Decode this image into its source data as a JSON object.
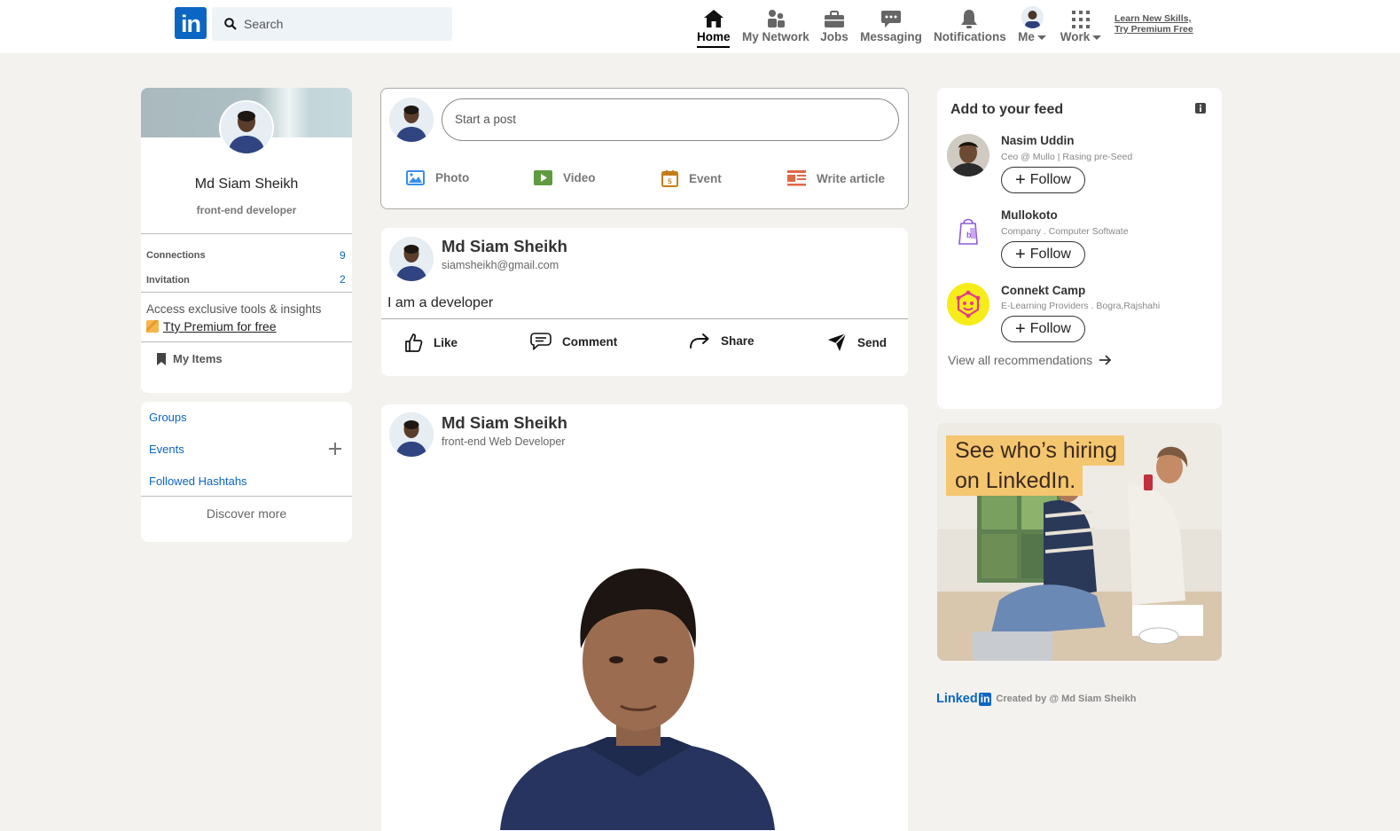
{
  "nav": {
    "logo_text": "in",
    "search_placeholder": "Search",
    "items": [
      {
        "label": "Home",
        "icon": "home-icon"
      },
      {
        "label": "My Network",
        "icon": "network-icon"
      },
      {
        "label": "Jobs",
        "icon": "briefcase-icon"
      },
      {
        "label": "Messaging",
        "icon": "messaging-icon"
      },
      {
        "label": "Notifications",
        "icon": "bell-icon"
      },
      {
        "label": "Me",
        "icon": "avatar"
      },
      {
        "label": "Work",
        "icon": "grid-icon"
      }
    ],
    "premium_line1": "Learn New Skills,",
    "premium_line2": "Try Premium Free"
  },
  "profile": {
    "name": "Md Siam Sheikh",
    "headline": "front-end developer",
    "connections_label": "Connections",
    "connections_value": "9",
    "invitation_label": "Invitation",
    "invitation_value": "2",
    "premium_text": "Access exclusive tools & insights",
    "premium_link": "Tty Premium for free",
    "my_items": "My Items"
  },
  "communities": {
    "groups": "Groups",
    "events": "Events",
    "hashtags": "Followed Hashtahs",
    "discover": "Discover more"
  },
  "composer": {
    "placeholder": "Start a post",
    "actions": [
      "Photo",
      "Video",
      "Event",
      "Write article"
    ],
    "colors": {
      "photo": "#378fe9",
      "video": "#5f9b41",
      "event": "#c37d16",
      "article": "#e06847"
    }
  },
  "posts": [
    {
      "author": "Md Siam Sheikh",
      "subtitle": "siamsheikh@gmail.com",
      "text": "I am a developer",
      "actions": [
        "Like",
        "Comment",
        "Share",
        "Send"
      ]
    },
    {
      "author": "Md Siam Sheikh",
      "subtitle": "front-end Web Developer"
    }
  ],
  "feed": {
    "title": "Add to your feed",
    "items": [
      {
        "name": "Nasim Uddin",
        "sub": "Ceo @ Mullo | Rasing pre-Seed",
        "button": "Follow"
      },
      {
        "name": "Mullokoto",
        "sub": "Company . Computer Softwate",
        "button": "Follow"
      },
      {
        "name": "Connekt Camp",
        "sub": "E-Learning Providers . Bogra,Rajshahi",
        "button": "Follow"
      }
    ],
    "view_all": "View all recommendations"
  },
  "ad": {
    "line1": "See who’s hiring",
    "line2": "on LinkedIn."
  },
  "footer": {
    "brand": "Linked",
    "brand_in": "in",
    "credit": "Created by @ Md Siam Sheikh"
  }
}
